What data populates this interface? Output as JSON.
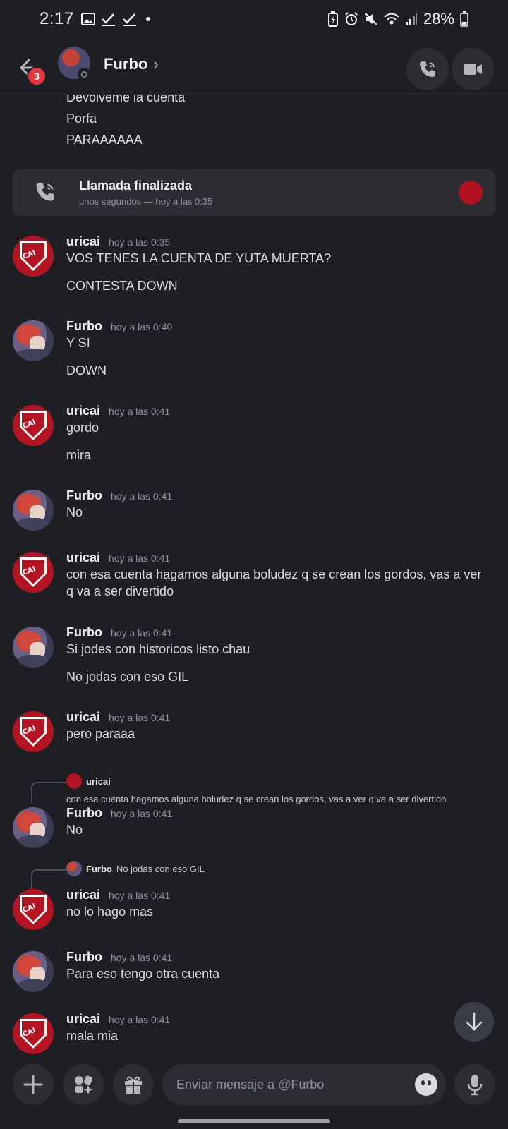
{
  "status_bar": {
    "time": "2:17",
    "battery": "28%"
  },
  "header": {
    "back_badge": "3",
    "contact_name": "Furbo",
    "chevron": "›"
  },
  "loose_lines": [
    "Devolveme la cuenta",
    "Porfa",
    "PARAAAAAA"
  ],
  "call": {
    "title": "Llamada finalizada",
    "subtitle": "unos segundos — hoy a las 0:35"
  },
  "messages": [
    {
      "user": "uricai",
      "time": "hoy a las 0:35",
      "lines": [
        "VOS TENES LA CUENTA DE YUTA MUERTA?",
        "CONTESTA DOWN"
      ]
    },
    {
      "user": "Furbo",
      "time": "hoy a las 0:40",
      "lines": [
        "Y SI",
        "DOWN"
      ]
    },
    {
      "user": "uricai",
      "time": "hoy a las 0:41",
      "lines": [
        "gordo",
        "mira"
      ]
    },
    {
      "user": "Furbo",
      "time": "hoy a las 0:41",
      "lines": [
        "No"
      ]
    },
    {
      "user": "uricai",
      "time": "hoy a las 0:41",
      "lines": [
        "con esa cuenta hagamos alguna boludez q se crean los gordos, vas a ver q va a ser divertido"
      ]
    },
    {
      "user": "Furbo",
      "time": "hoy a las 0:41",
      "lines": [
        "Si jodes con historicos listo chau",
        "No jodas con eso GIL"
      ]
    },
    {
      "user": "uricai",
      "time": "hoy a las 0:41",
      "lines": [
        "pero paraaa"
      ]
    },
    {
      "user": "Furbo",
      "time": "hoy a las 0:41",
      "lines": [
        "No"
      ],
      "reply": {
        "user": "uricai",
        "text": "con esa cuenta hagamos alguna boludez q se crean los gordos, vas a ver q va a ser divertido"
      }
    },
    {
      "user": "uricai",
      "time": "hoy a las 0:41",
      "lines": [
        "no lo hago mas"
      ],
      "reply": {
        "user": "Furbo",
        "text": "No jodas con eso GIL"
      }
    },
    {
      "user": "Furbo",
      "time": "hoy a las 0:41",
      "lines": [
        "Para eso tengo otra cuenta"
      ]
    },
    {
      "user": "uricai",
      "time": "hoy a las 0:41",
      "lines": [
        "mala mia"
      ]
    }
  ],
  "composer": {
    "placeholder": "Enviar mensaje a @Furbo"
  },
  "icons": {
    "back": "arrow-left-icon",
    "call": "phone-icon",
    "video": "video-camera-icon",
    "add": "plus-icon",
    "apps": "apps-icon",
    "gift": "gift-icon",
    "emoji": "emoji-icon",
    "mic": "microphone-icon",
    "scroll": "arrow-down-icon"
  },
  "colors": {
    "background": "#1e1f24",
    "card": "#2b2d33",
    "badge": "#e5363d",
    "muted_text": "#8f929a"
  }
}
